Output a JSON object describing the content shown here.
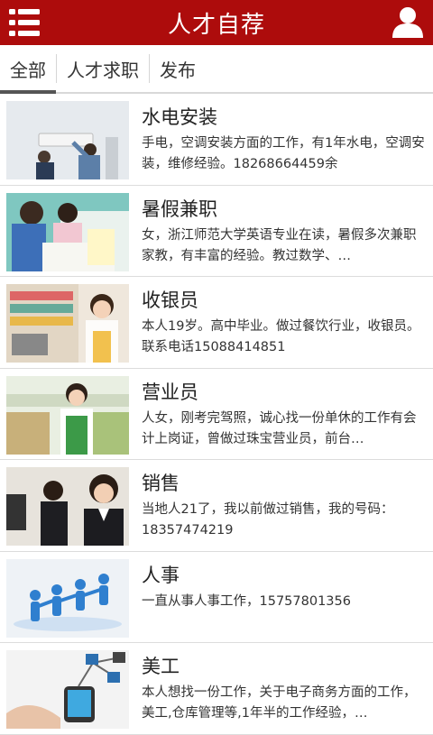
{
  "header": {
    "title": "人才自荐",
    "menu_icon": "list-menu-icon",
    "user_icon": "user-icon",
    "color": "#ad0c0c"
  },
  "tabs": [
    {
      "label": "全部",
      "active": true
    },
    {
      "label": "人才求职",
      "active": false
    },
    {
      "label": "发布",
      "active": false
    }
  ],
  "items": [
    {
      "title": "水电安装",
      "desc": "手电，空调安装方面的工作，有1年水电，空调安装，维修经验。18268664459余"
    },
    {
      "title": "暑假兼职",
      "desc": "女，浙江师范大学英语专业在读，暑假多次兼职家教，有丰富的经验。教过数学、…"
    },
    {
      "title": "收银员",
      "desc": "本人19岁。高中毕业。做过餐饮行业，收银员。联系电话15088414851"
    },
    {
      "title": "营业员",
      "desc": "人女，刚考完驾照，诚心找一份单休的工作有会计上岗证，曾做过珠宝营业员，前台…"
    },
    {
      "title": "销售",
      "desc": "当地人21了，我以前做过销售，我的号码：18357474219"
    },
    {
      "title": "人事",
      "desc": "一直从事人事工作，15757801356"
    },
    {
      "title": "美工",
      "desc": "本人想找一份工作，关于电子商务方面的工作，美工,仓库管理等,1年半的工作经验，…"
    }
  ]
}
